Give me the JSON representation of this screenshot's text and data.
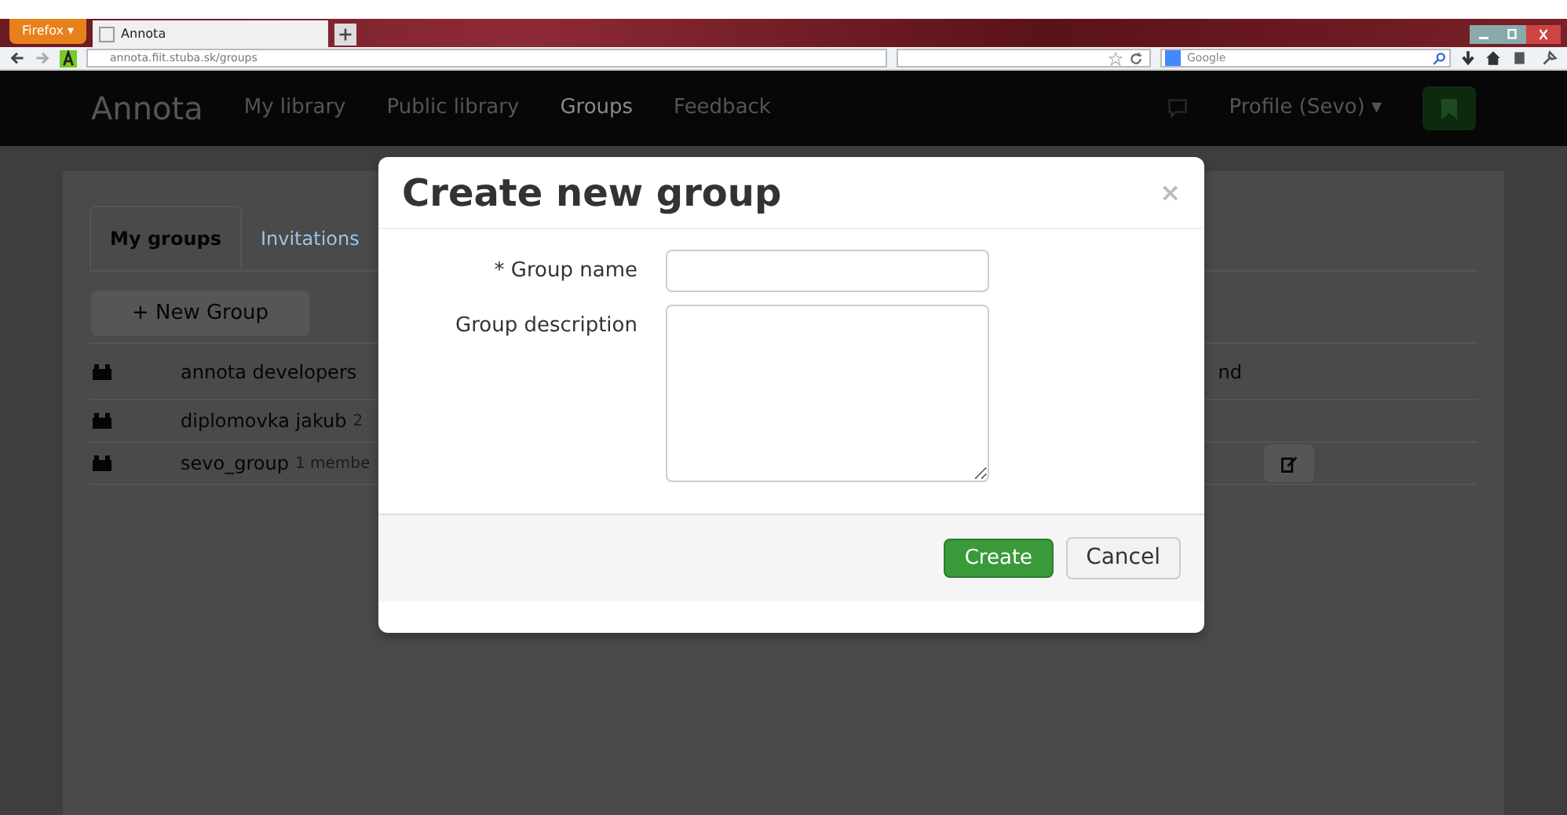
{
  "browser": {
    "menu_button": "Firefox ▾",
    "tab_title": "Annota",
    "url": "annota.fiit.stuba.sk/groups",
    "search_placeholder": "Google"
  },
  "navbar": {
    "brand": "Annota",
    "items": [
      {
        "label": "My library",
        "selected": false
      },
      {
        "label": "Public library",
        "selected": false
      },
      {
        "label": "Groups",
        "selected": true
      },
      {
        "label": "Feedback",
        "selected": false
      }
    ],
    "profile": "Profile (Sevo) ▾"
  },
  "tabs": [
    {
      "label": "My groups",
      "selected": true
    },
    {
      "label": "Invitations",
      "selected": false
    }
  ],
  "new_group_button": "+ New Group",
  "groups": [
    {
      "name": "annota developers",
      "column_2": "nd",
      "editable": false
    },
    {
      "name": "diplomovka jakub",
      "members": "2",
      "editable": false
    },
    {
      "name": "sevo_group",
      "members": "1 membe",
      "editable": true
    }
  ],
  "modal": {
    "title": "Create new group",
    "close": "×",
    "fields": [
      {
        "kind": "input",
        "required_mark": "*",
        "label": "Group name"
      },
      {
        "kind": "textarea",
        "label": "Group description"
      }
    ],
    "buttons": [
      {
        "label": "Create",
        "kind": "primary"
      },
      {
        "label": "Cancel",
        "kind": "default"
      }
    ]
  }
}
